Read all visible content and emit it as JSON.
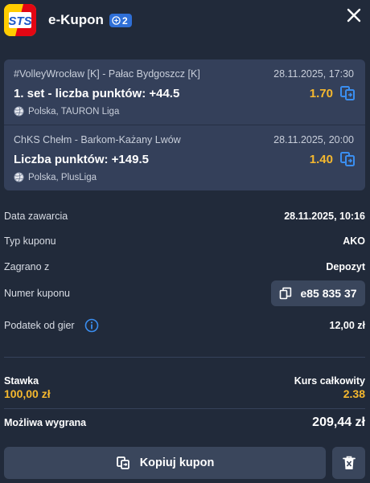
{
  "header": {
    "logo_text": "STS",
    "title": "e-Kupon",
    "badge_count": "2",
    "colors": {
      "badge": "#2f6fd6",
      "background": "#212a3a"
    }
  },
  "bets": [
    {
      "match": "#VolleyWrocław [K] - Pałac Bydgoszcz [K]",
      "date": "28.11.2025, 17:30",
      "selection": "1. set - liczba punktów: +44.5",
      "odds": "1.70",
      "league": "Polska, TAURON Liga",
      "sport_icon": "volleyball-icon"
    },
    {
      "match": "ChKS Chełm - Barkom-Każany Lwów",
      "date": "28.11.2025, 20:00",
      "selection": "Liczba punktów: +149.5",
      "odds": "1.40",
      "league": "Polska, PlusLiga",
      "sport_icon": "volleyball-icon"
    }
  ],
  "details": {
    "date_label": "Data zawarcia",
    "date_value": "28.11.2025, 10:16",
    "type_label": "Typ kuponu",
    "type_value": "AKO",
    "played_label": "Zagrano z",
    "played_value": "Depozyt",
    "number_label": "Numer kuponu",
    "number_value": "e85 835 37",
    "tax_label": "Podatek od gier",
    "tax_value": "12,00 zł"
  },
  "summary": {
    "stake_label": "Stawka",
    "stake_value": "100,00 zł",
    "odds_label": "Kurs całkowity",
    "odds_value": "2.38",
    "win_label": "Możliwa wygrana",
    "win_value": "209,44 zł",
    "accent_color": "#f5b82e"
  },
  "actions": {
    "copy_label": "Kopiuj kupon"
  }
}
